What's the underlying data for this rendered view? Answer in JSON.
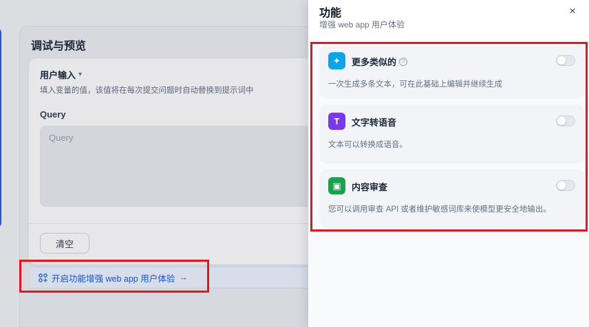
{
  "debug": {
    "title": "调试与预览",
    "user_input_label": "用户输入",
    "user_input_desc": "填入变量的值，该值将在每次提交问题时自动替换到提示词中",
    "query_label": "Query",
    "query_placeholder": "Query",
    "clear_label": "清空",
    "enhance_link": "开启功能增强 web app 用户体验",
    "enhance_arrow": "→"
  },
  "drawer": {
    "title": "功能",
    "subtitle": "增强 web app 用户体验",
    "close": "×",
    "features": [
      {
        "name": "更多类似的",
        "desc": "一次生成多条文本，可在此基础上编辑并继续生成",
        "icon": "sparkle-icon",
        "color": "#0ba5ec",
        "glyph": "✦",
        "enabled": false,
        "has_help": true
      },
      {
        "name": "文字转语音",
        "desc": "文本可以转换成语音。",
        "icon": "text-to-speech-icon",
        "color": "#7839ee",
        "glyph": "T",
        "enabled": false,
        "has_help": false
      },
      {
        "name": "内容审查",
        "desc": "您可以调用审查 API 或者维护敏感词库来使模型更安全地输出。",
        "icon": "shield-check-icon",
        "color": "#16a34a",
        "glyph": "▣",
        "enabled": false,
        "has_help": false
      }
    ]
  },
  "colors": {
    "accent": "#155eef",
    "highlight": "#e8141c"
  }
}
